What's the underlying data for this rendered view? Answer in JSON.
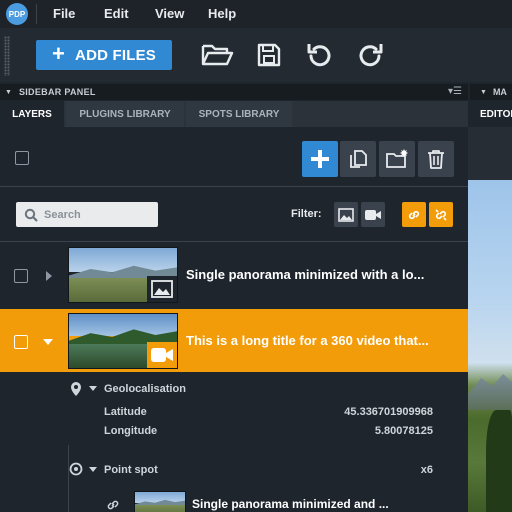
{
  "menubar": {
    "logo": "PDP",
    "items": [
      {
        "label": "File"
      },
      {
        "label": "Edit"
      },
      {
        "label": "View"
      },
      {
        "label": "Help"
      }
    ]
  },
  "toolbar": {
    "add_files_label": "ADD FILES",
    "icons": [
      "folder-open-icon",
      "save-icon",
      "undo-icon",
      "redo-icon"
    ]
  },
  "sidebar": {
    "header_title": "SIDEBAR PANEL",
    "right_header_title": "MA",
    "tabs": [
      {
        "label": "LAYERS",
        "active": true
      },
      {
        "label": "PLUGINS LIBRARY",
        "active": false
      },
      {
        "label": "SPOTS LIBRARY",
        "active": false
      }
    ],
    "editor_tab_label": "EDITOR",
    "search": {
      "placeholder": "Search",
      "value": ""
    },
    "filter_label": "Filter:",
    "layers": [
      {
        "title": "Single panorama minimized with a lo...",
        "type": "image",
        "expanded": false,
        "selected": false
      },
      {
        "title": "This is a long title for a 360 video that...",
        "type": "video",
        "expanded": true,
        "selected": true
      }
    ],
    "geolocalisation": {
      "label": "Geolocalisation",
      "latitude_label": "Latitude",
      "latitude_value": "45.336701909968",
      "longitude_label": "Longitude",
      "longitude_value": "5.80078125"
    },
    "point_spot": {
      "label": "Point spot",
      "count": "x6",
      "item_title": "Single panorama minimized and ..."
    }
  },
  "colors": {
    "accent_blue": "#3189d3",
    "selection_orange": "#f39c0a",
    "panel_bg": "#1f252d"
  }
}
